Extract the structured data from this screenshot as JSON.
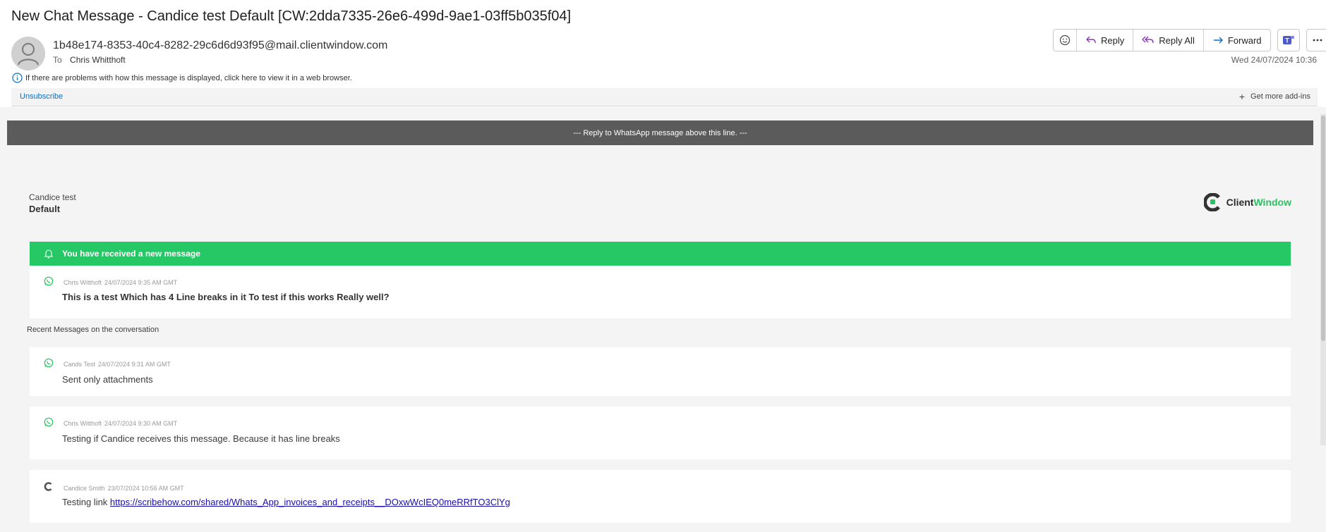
{
  "email": {
    "subject": "New Chat Message  - Candice test Default [CW:2dda7335-26e6-499d-9ae1-03ff5b035f04]",
    "sender": "1b48e174-8353-40c4-8282-29c6d6d93f95@mail.clientwindow.com",
    "to_label": "To",
    "to_name": "Chris Whitthoft",
    "date": "Wed 24/07/2024 10:36",
    "info_text": "If there are problems with how this message is displayed, click here to view it in a web browser.",
    "unsubscribe": "Unsubscribe",
    "get_addins": "Get more add-ins"
  },
  "toolbar": {
    "reply": "Reply",
    "reply_all": "Reply All",
    "forward": "Forward",
    "emoji_icon": "emoji-icon",
    "teams_icon": "teams-icon",
    "more_icon": "more-icon"
  },
  "body": {
    "reply_bar": "--- Reply to WhatsApp message above this line. ---",
    "account_name": "Candice test",
    "account_sub": "Default",
    "brand_part1": "Client",
    "brand_part2": "Window",
    "notification": "You have received a new message",
    "new_message": {
      "author": "Chris Witthoft",
      "time": "24/07/2024 9:35 AM GMT",
      "text": "This is a test Which has 4 Line breaks in it To test if this works Really well?"
    },
    "recent_label": "Recent Messages on the conversation",
    "recent": [
      {
        "author": "Cands Test",
        "time": "24/07/2024 9:31 AM GMT",
        "text": "Sent only attachments",
        "icon": "whatsapp-icon"
      },
      {
        "author": "Chris Witthoft",
        "time": "24/07/2024 9:30 AM GMT",
        "text": "Testing if Candice receives this message. Because it has line breaks",
        "icon": "whatsapp-icon"
      },
      {
        "author": "Candice Smith",
        "time": "23/07/2024 10:56 AM GMT",
        "text_prefix": "Testing link ",
        "link": "https://scribehow.com/shared/Whats_App_invoices_and_receipts__DOxwWcIEQ0meRRfTO3ClYg",
        "icon": "clientwindow-icon"
      }
    ]
  },
  "colors": {
    "green": "#25c864",
    "dark_bar": "#5b5b5b",
    "link": "#1a0dab",
    "purple_icon": "#8a3ab9",
    "teams": "#5059c9"
  }
}
